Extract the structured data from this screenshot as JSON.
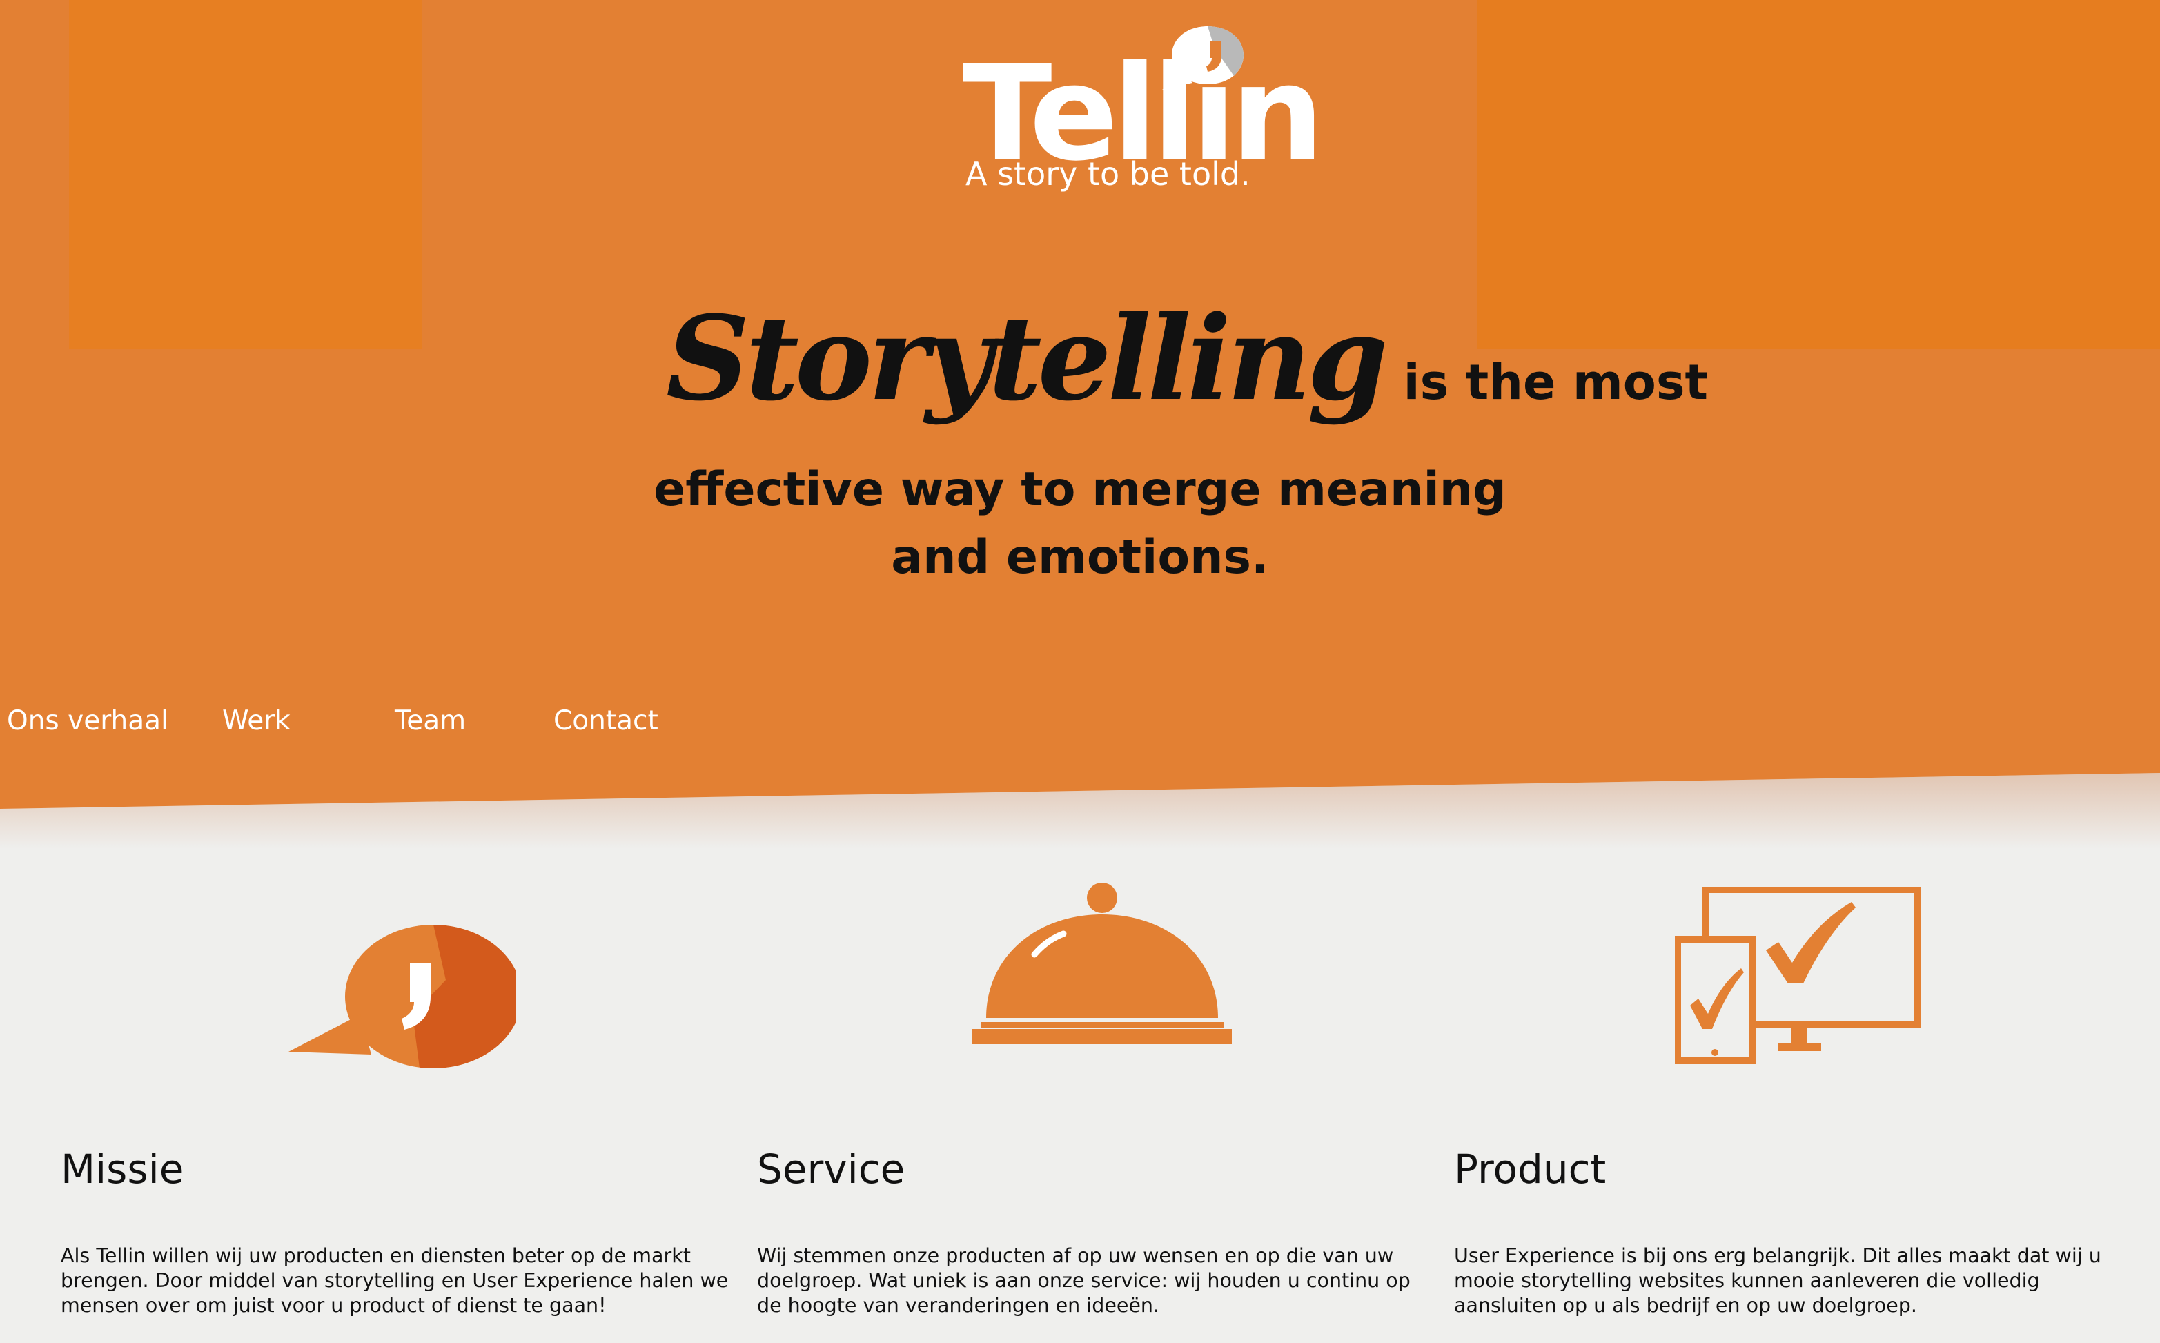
{
  "colors": {
    "brand_orange": "#e38033",
    "panel_orange": "#e67e22",
    "dark_orange": "#d35a1c",
    "background": "#efefed",
    "text": "#111111"
  },
  "logo": {
    "word": "Tellin",
    "tagline": "A story to be told.",
    "icon": "speech-bubble-icon"
  },
  "headline": {
    "script_word": "Storytelling",
    "line1_rest": "is the most",
    "line2": "effective way to merge meaning",
    "line3": "and emotions."
  },
  "nav": {
    "items": [
      {
        "label": "Ons verhaal"
      },
      {
        "label": "Werk"
      },
      {
        "label": "Team"
      },
      {
        "label": "Contact"
      }
    ]
  },
  "features": [
    {
      "icon": "speech-bubble-icon",
      "title": "Missie",
      "text": "Als Tellin willen wij uw producten en diensten beter op de markt brengen. Door middel van storytelling en User Experience halen we mensen over om juist voor u product of dienst te gaan!"
    },
    {
      "icon": "service-bell-icon",
      "title": "Service",
      "text": "Wij stemmen onze producten af op uw wensen en op die van uw doelgroep. Wat uniek is aan onze service: wij houden u continu op de hoogte van veranderingen en ideeën."
    },
    {
      "icon": "devices-check-icon",
      "title": "Product",
      "text": "User Experience is bij ons erg belangrijk. Dit alles maakt dat wij u mooie storytelling websites kunnen aanleveren die volledig aansluiten op u als bedrijf en op uw doelgroep."
    }
  ]
}
